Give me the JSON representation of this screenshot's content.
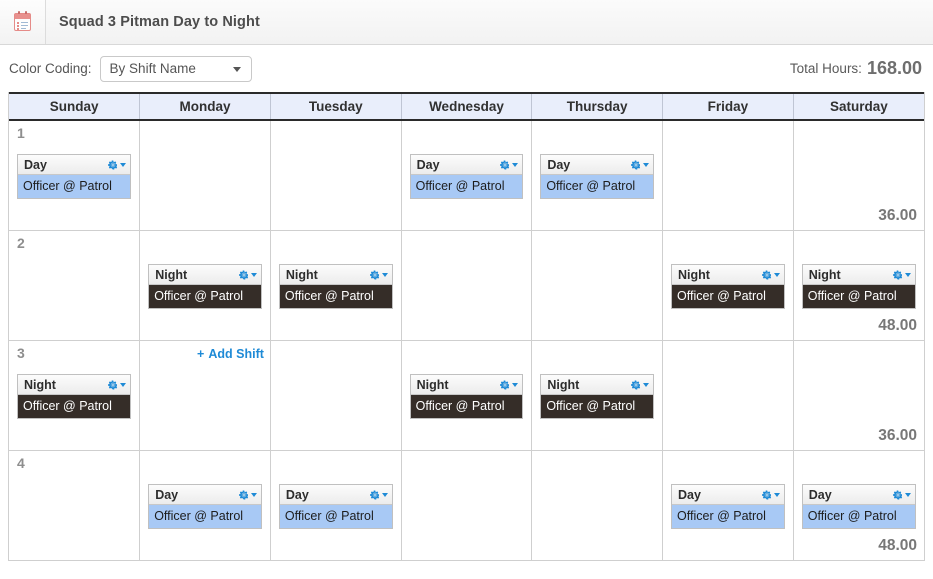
{
  "window": {
    "icon": "calendar-icon",
    "title": "Squad 3 Pitman Day to Night"
  },
  "toolbar": {
    "color_coding_label": "Color Coding:",
    "color_coding_value": "By Shift Name",
    "color_coding_options": [
      "By Shift Name"
    ],
    "total_hours_label": "Total Hours:",
    "total_hours_value": "168.00"
  },
  "calendar": {
    "day_headers": [
      "Sunday",
      "Monday",
      "Tuesday",
      "Wednesday",
      "Thursday",
      "Friday",
      "Saturday"
    ],
    "add_shift_label": "Add Shift",
    "add_shift_plus": "+",
    "gear_icon": "gear-icon",
    "caret_icon": "chevron-down-icon",
    "rows": [
      {
        "number": "1",
        "total": "36.00",
        "add_shift_col": -1,
        "cells": [
          {
            "shift": {
              "name": "Day",
              "assignment": "Officer @ Patrol",
              "type": "day"
            }
          },
          {},
          {},
          {
            "shift": {
              "name": "Day",
              "assignment": "Officer @ Patrol",
              "type": "day"
            }
          },
          {
            "shift": {
              "name": "Day",
              "assignment": "Officer @ Patrol",
              "type": "day"
            }
          },
          {},
          {}
        ]
      },
      {
        "number": "2",
        "total": "48.00",
        "add_shift_col": -1,
        "cells": [
          {},
          {
            "shift": {
              "name": "Night",
              "assignment": "Officer @ Patrol",
              "type": "night"
            }
          },
          {
            "shift": {
              "name": "Night",
              "assignment": "Officer @ Patrol",
              "type": "night"
            }
          },
          {},
          {},
          {
            "shift": {
              "name": "Night",
              "assignment": "Officer @ Patrol",
              "type": "night"
            }
          },
          {
            "shift": {
              "name": "Night",
              "assignment": "Officer @ Patrol",
              "type": "night"
            }
          }
        ]
      },
      {
        "number": "3",
        "total": "36.00",
        "add_shift_col": 1,
        "cells": [
          {
            "shift": {
              "name": "Night",
              "assignment": "Officer @ Patrol",
              "type": "night"
            }
          },
          {},
          {},
          {
            "shift": {
              "name": "Night",
              "assignment": "Officer @ Patrol",
              "type": "night"
            }
          },
          {
            "shift": {
              "name": "Night",
              "assignment": "Officer @ Patrol",
              "type": "night"
            }
          },
          {},
          {}
        ]
      },
      {
        "number": "4",
        "total": "48.00",
        "add_shift_col": -1,
        "cells": [
          {},
          {
            "shift": {
              "name": "Day",
              "assignment": "Officer @ Patrol",
              "type": "day"
            }
          },
          {
            "shift": {
              "name": "Day",
              "assignment": "Officer @ Patrol",
              "type": "day"
            }
          },
          {},
          {},
          {
            "shift": {
              "name": "Day",
              "assignment": "Officer @ Patrol",
              "type": "day"
            }
          },
          {
            "shift": {
              "name": "Day",
              "assignment": "Officer @ Patrol",
              "type": "day"
            }
          }
        ]
      }
    ]
  },
  "colors": {
    "day_shift_body": "#a8c9f5",
    "night_shift_body": "#352d28",
    "header_background": "#e9eefb",
    "accent_link": "#1e8ad6",
    "total_hours_text": "#6e6e6e"
  }
}
